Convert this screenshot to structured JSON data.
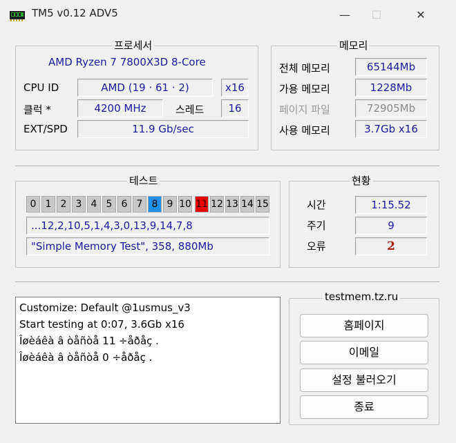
{
  "window": {
    "title": "TM5 v0.12 ADV5",
    "minimize_icon": "minimize-icon",
    "maximize_icon": "maximize-icon",
    "close_icon": "close-icon",
    "minimize_glyph": "—",
    "maximize_glyph": "☐",
    "close_glyph": "✕"
  },
  "processor": {
    "title": "프로세서",
    "name": "AMD Ryzen 7 7800X3D 8-Core",
    "cpu_id_label": "CPU ID",
    "cpu_id": "AMD  (19 · 61 · 2)",
    "cpu_mult": "x16",
    "clock_label": "클럭 *",
    "clock": "4200 MHz",
    "threads_label": "스레드",
    "threads": "16",
    "ext_label": "EXT/SPD",
    "ext": "11.9 Gb/sec"
  },
  "memory": {
    "title": "메모리",
    "total_label": "전체 메모리",
    "total": "65144Mb",
    "avail_label": "가용 메모리",
    "avail": "1228Mb",
    "page_label": "페이지 파일",
    "page": "72905Mb",
    "used_label": "사용 메모리",
    "used": "3.7Gb x16"
  },
  "test": {
    "title": "테스트",
    "cells": [
      "0",
      "1",
      "2",
      "3",
      "4",
      "5",
      "6",
      "7",
      "8",
      "9",
      "10",
      "11",
      "12",
      "13",
      "14",
      "15"
    ],
    "active_cell": 8,
    "error_cell": 11,
    "active_color": "#1e90e8",
    "error_color": "#e80000",
    "sequence": "...12,2,10,5,1,4,3,0,13,9,14,7,8",
    "current": "\"Simple Memory Test\", 358, 880Mb"
  },
  "status": {
    "title": "현황",
    "time_label": "시간",
    "time": "1:15.52",
    "cycle_label": "주기",
    "cycle": "9",
    "error_label": "오류",
    "errors": "2"
  },
  "log": {
    "lines": [
      "Customize: Default @1usmus_v3",
      "Start testing at 0:07, 3.6Gb x16",
      "Îøèáêà â òåñòå 11 ÷åðåç .",
      "Îøèáêà â òåñòå 0 ÷åðåç ."
    ]
  },
  "links": {
    "title": "testmem.tz.ru",
    "homepage": "홈페이지",
    "email": "이메일",
    "load_settings": "설정 불러오기",
    "exit": "종료"
  }
}
